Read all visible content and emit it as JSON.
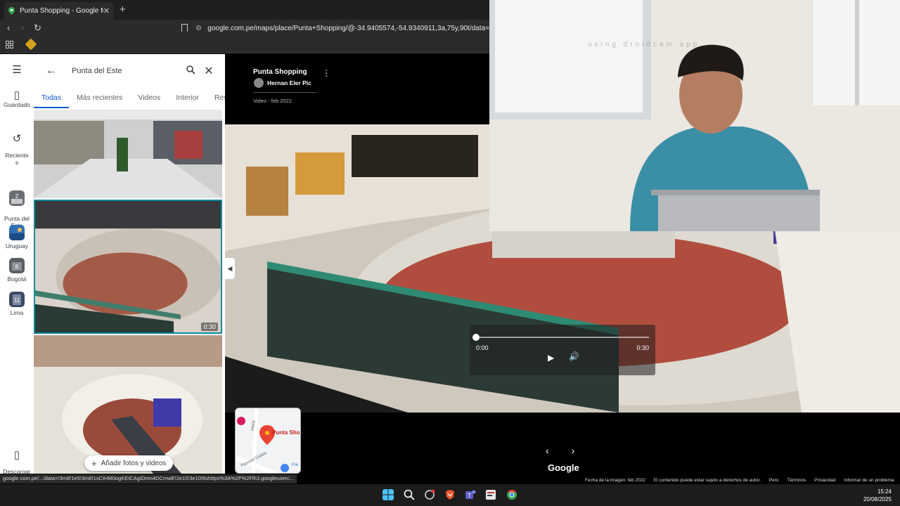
{
  "browser": {
    "tab_title": "Punta Shopping - Google Maps",
    "tab_close": "✕",
    "new_tab": "+",
    "url": "google.com.pe/maps/place/Punta+Shopping/@-34.9405574,-54.9340911,3a,75y,90t/data=!3m",
    "status_url": "google.com.pe/.../data=!3m8!1e5!3m6!1sCIHM0ogKEICAgIDmn4DCmwE!2e10!3e10!6shttps%3A%2F%2Flh3.googleuserc..."
  },
  "rail": {
    "menu_icon": "☰",
    "items": [
      {
        "icon": "bookmark-icon",
        "glyph": "▯",
        "label": "Guardado"
      },
      {
        "icon": "history-icon",
        "glyph": "↺",
        "label": "Reciente\ns"
      },
      {
        "icon": "place-thumb",
        "label": "Punta del\nEste"
      },
      {
        "icon": "place-thumb",
        "label": "Uruguay"
      },
      {
        "icon": "place-thumb",
        "label": "Bogotá"
      },
      {
        "icon": "place-thumb",
        "label": "Lima"
      },
      {
        "icon": "phone-icon",
        "glyph": "▯",
        "label": "Descargar\nla..."
      }
    ]
  },
  "search": {
    "query": "Punta del Este",
    "back_glyph": "←",
    "search_glyph": "🔍",
    "close_glyph": "✕"
  },
  "filters": [
    "Todas",
    "Más recientes",
    "Videos",
    "Interior",
    "Resta"
  ],
  "photos": {
    "duration": "0:30",
    "add_label": "Añadir fotos y videos"
  },
  "viewer": {
    "title": "Punta Shopping",
    "author": "Hernan Eler Pic",
    "date": "Video - feb 2022",
    "more_glyph": "⋮"
  },
  "player": {
    "current": "0:00",
    "total": "0:30",
    "progress": 0.0
  },
  "minimap": {
    "label": "Punta Sho",
    "street": "Pascual Gattas",
    "street2": "Vieira",
    "fre": "Fre"
  },
  "nav": {
    "prev": "‹",
    "next": "›",
    "brand": "Google"
  },
  "webcam": {
    "watermark": "using droidcam app"
  },
  "footer": {
    "image_date": "Fecha de la imagen: feb 2022",
    "copyright": "El contenido puede estar sujeto a derechos de autor.",
    "links": [
      "Perú",
      "Términos",
      "Privacidad",
      "Informar de un problema"
    ]
  },
  "taskbar": {
    "time": "15:24",
    "date": "20/08/2025"
  },
  "colors": {
    "accent": "#0b57d0",
    "map_pin": "#ea4335"
  }
}
